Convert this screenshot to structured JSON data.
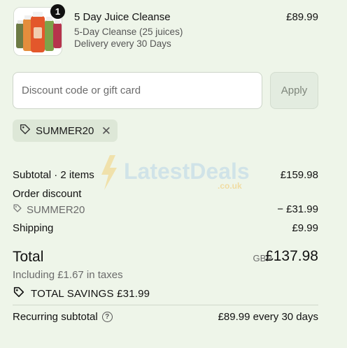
{
  "product": {
    "quantity_badge": "1",
    "name": "5 Day Juice Cleanse",
    "variant": "5-Day Cleanse (25 juices)",
    "delivery": "Delivery every 30 Days",
    "price": "£89.99",
    "image_icon": "juice-bottles-image"
  },
  "discount": {
    "placeholder": "Discount code or gift card",
    "apply_label": "Apply",
    "applied_code": "SUMMER20",
    "remove_icon": "close-icon",
    "tag_icon": "tag-icon"
  },
  "watermark": {
    "brand": "LatestDeals",
    "suffix": ".co.uk"
  },
  "summary": {
    "subtotal_label": "Subtotal · 2 items",
    "subtotal_value": "£159.98",
    "order_discount_label": "Order discount",
    "discount_code": "SUMMER20",
    "discount_value": "− £31.99",
    "shipping_label": "Shipping",
    "shipping_value": "£9.99",
    "total_label": "Total",
    "currency": "GBP",
    "total_value": "£137.98",
    "tax_note": "Including £1.67 in taxes",
    "savings_label": "TOTAL SAVINGS £31.99",
    "recurring_label": "Recurring subtotal",
    "recurring_value": "£89.99 every 30 days",
    "help_icon": "help-icon"
  },
  "colors": {
    "background": "#eef5e9",
    "chip": "#dde7d7",
    "apply_button": "#e3ece0"
  }
}
